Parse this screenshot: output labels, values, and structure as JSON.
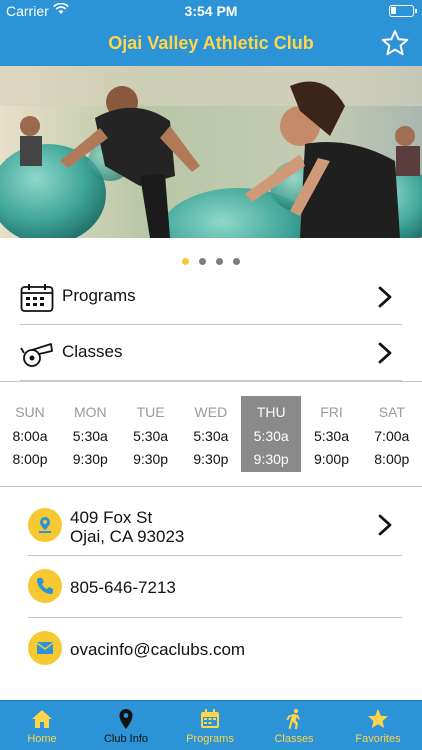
{
  "status_bar": {
    "carrier": "Carrier",
    "time": "3:54 PM"
  },
  "nav": {
    "title": "Ojai Valley Athletic Club",
    "favorite_icon": "star-icon"
  },
  "carousel": {
    "page_count": 4,
    "current_page": 1
  },
  "menu": [
    {
      "label": "Programs",
      "icon": "calendar-icon"
    },
    {
      "label": "Classes",
      "icon": "whistle-icon"
    }
  ],
  "hours": [
    {
      "day": "SUN",
      "open": "8:00a",
      "close": "8:00p"
    },
    {
      "day": "MON",
      "open": "5:30a",
      "close": "9:30p"
    },
    {
      "day": "TUE",
      "open": "5:30a",
      "close": "9:30p"
    },
    {
      "day": "WED",
      "open": "5:30a",
      "close": "9:30p"
    },
    {
      "day": "THU",
      "open": "5:30a",
      "close": "9:30p",
      "today": true
    },
    {
      "day": "FRI",
      "open": "5:30a",
      "close": "9:00p"
    },
    {
      "day": "SAT",
      "open": "7:00a",
      "close": "8:00p"
    }
  ],
  "contact": {
    "address_line1": "409 Fox St",
    "address_line2": "Ojai, CA 93023",
    "phone": "805-646-7213",
    "email": "ovacinfo@caclubs.com"
  },
  "tabs": [
    {
      "label": "Home",
      "icon": "home-icon"
    },
    {
      "label": "Club Info",
      "icon": "map-pin-icon",
      "active": true
    },
    {
      "label": "Programs",
      "icon": "calendar-icon"
    },
    {
      "label": "Classes",
      "icon": "runner-icon"
    },
    {
      "label": "Favorites",
      "icon": "star-icon"
    }
  ],
  "colors": {
    "brand_blue": "#2b93d6",
    "accent_yellow": "#f6c932",
    "today_gray": "#8a8a8a"
  }
}
